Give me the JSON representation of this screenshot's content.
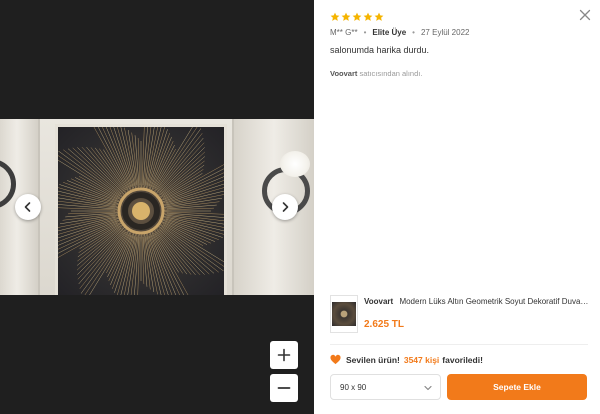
{
  "review": {
    "rating": 5,
    "user": "M** G**",
    "badge": "Elite Üye",
    "date": "27 Eylül 2022",
    "comment": "salonumda harika durdu.",
    "seller_name": "Voovart",
    "seller_suffix": "satıcısından alındı."
  },
  "product": {
    "brand": "Voovart",
    "name": "Modern Lüks Altın Geometrik Soyut Dekoratif Duvar Lambası",
    "price": "2.625 TL"
  },
  "favorite": {
    "prefix": "Sevilen ürün!",
    "count": "3547 kişi",
    "suffix": "favoriledi!"
  },
  "size_select": {
    "value": "90 x 90"
  },
  "cart_button": {
    "label": "Sepete Ekle"
  },
  "colors": {
    "accent": "#f27a1a",
    "star": "#f5b400",
    "heart": "#f27a1a"
  },
  "icons": [
    "close-icon",
    "star-icon",
    "chevron-left-icon",
    "chevron-right-icon",
    "plus-icon",
    "minus-icon",
    "heart-icon",
    "chevron-down-icon"
  ]
}
